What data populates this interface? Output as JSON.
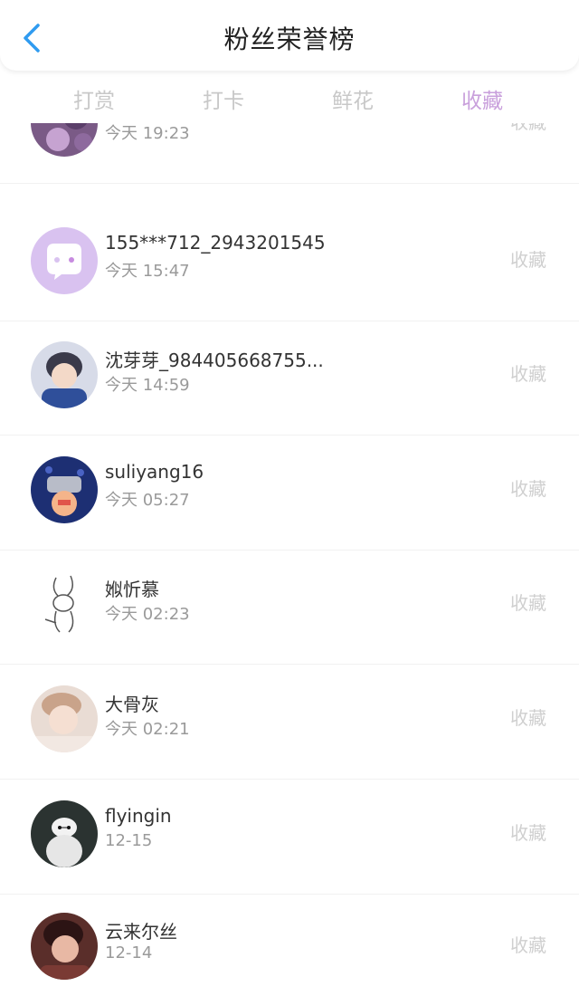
{
  "header": {
    "title": "粉丝荣誉榜"
  },
  "tabs": [
    {
      "label": "打赏"
    },
    {
      "label": "打卡"
    },
    {
      "label": "鲜花"
    },
    {
      "label": "收藏"
    }
  ],
  "active_tab": "收藏",
  "rows": [
    {
      "name": "",
      "time": "今天 19:23",
      "action": "收藏"
    },
    {
      "name": "155***712_2943201545",
      "time": "今天 15:47",
      "action": "收藏"
    },
    {
      "name": "沈芽芽_984405668755...",
      "time": "今天 14:59",
      "action": "收藏"
    },
    {
      "name": "suliyang16",
      "time": "今天 05:27",
      "action": "收藏"
    },
    {
      "name": "娰忻慕",
      "time": "今天 02:23",
      "action": "收藏"
    },
    {
      "name": "大骨灰",
      "time": "今天 02:21",
      "action": "收藏"
    },
    {
      "name": "flyingin",
      "time": "12-15",
      "action": "收藏"
    },
    {
      "name": "云来尔丝",
      "time": "12-14",
      "action": "收藏"
    }
  ],
  "colors": {
    "accent": "#c9a0dc",
    "back_arrow": "#2f9bf0",
    "tab_inactive": "#c8c8c8",
    "text_primary": "#333333",
    "text_secondary": "#9a9a9a"
  }
}
